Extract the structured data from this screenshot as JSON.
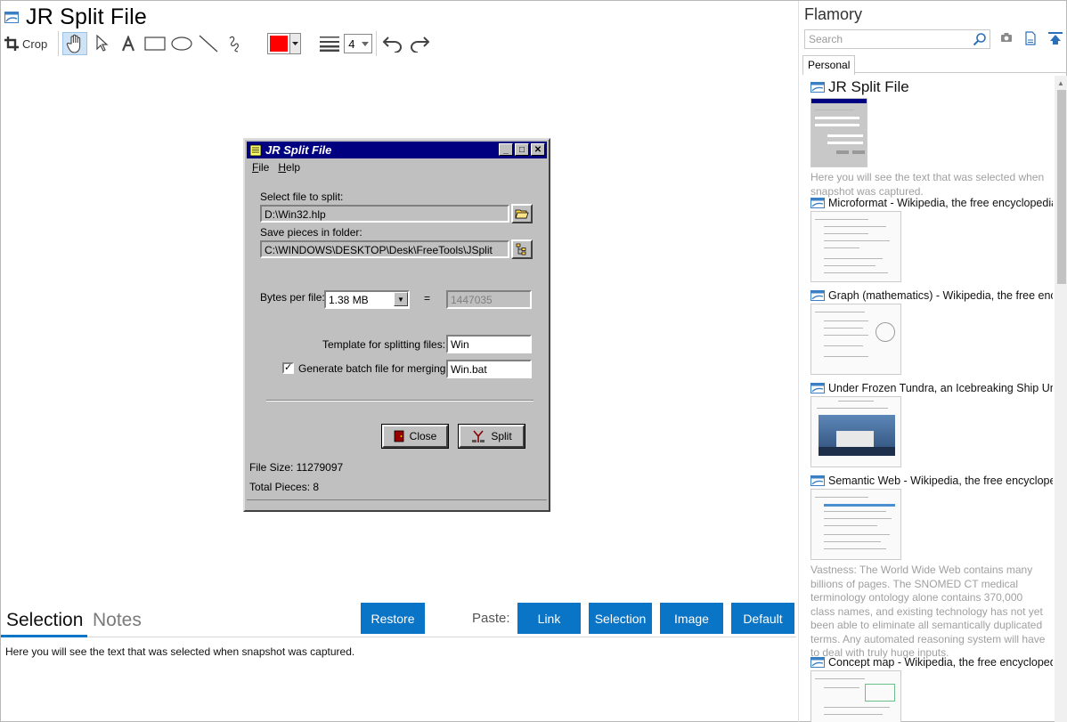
{
  "main": {
    "title": "JR Split File",
    "toolbar": {
      "crop_label": "Crop",
      "line_width": "4",
      "color": "#ff0000"
    }
  },
  "snapshot": {
    "window_title": "JR Split File",
    "menu": [
      "File",
      "Help"
    ],
    "select_file_label": "Select file to split:",
    "select_file_value": "D:\\Win32.hlp",
    "save_folder_label": "Save pieces in folder:",
    "save_folder_value": "C:\\WINDOWS\\DESKTOP\\Desk\\FreeTools\\JSplit",
    "bytes_label": "Bytes per file:",
    "bytes_value": "1.38  MB",
    "equals": "=",
    "bytes_exact": "1447035",
    "template_label": "Template for splitting files:",
    "template_value": "Win",
    "batch_label": "Generate batch file for merging:",
    "batch_value": "Win.bat",
    "close_label": "Close",
    "split_label": "Split",
    "file_size": "File Size: 11279097",
    "total_pieces": "Total Pieces: 8"
  },
  "bottom": {
    "tab_selection": "Selection",
    "tab_notes": "Notes",
    "restore_label": "Restore",
    "paste_label": "Paste:",
    "link_label": "Link",
    "selection_label": "Selection",
    "image_label": "Image",
    "default_label": "Default",
    "selection_text": "Here you will see the text that was selected when snapshot was captured.",
    "accent": "#0a74c6"
  },
  "side": {
    "title": "Flamory",
    "search_placeholder": "Search",
    "tab_personal": "Personal",
    "items": [
      {
        "name": "JR Split File",
        "desc": "Here you will see the text that was selected when snapshot was captured."
      },
      {
        "name": "Microformat - Wikipedia, the free encyclopedia",
        "desc": ""
      },
      {
        "name": "Graph (mathematics) - Wikipedia, the free encyclopedia",
        "desc": ""
      },
      {
        "name": "Under Frozen Tundra, an Icebreaking Ship Uncovers",
        "desc": ""
      },
      {
        "name": "Semantic Web - Wikipedia, the free encyclopedia",
        "desc": "Vastness: The World Wide Web contains many billions of pages. The SNOMED CT medical terminology ontology alone contains 370,000 class names, and existing technology has not yet been able to eliminate all semantically duplicated terms. Any automated reasoning system will have to deal with truly huge inputs."
      },
      {
        "name": "Concept map - Wikipedia, the free encyclopedia",
        "desc": ""
      }
    ]
  }
}
